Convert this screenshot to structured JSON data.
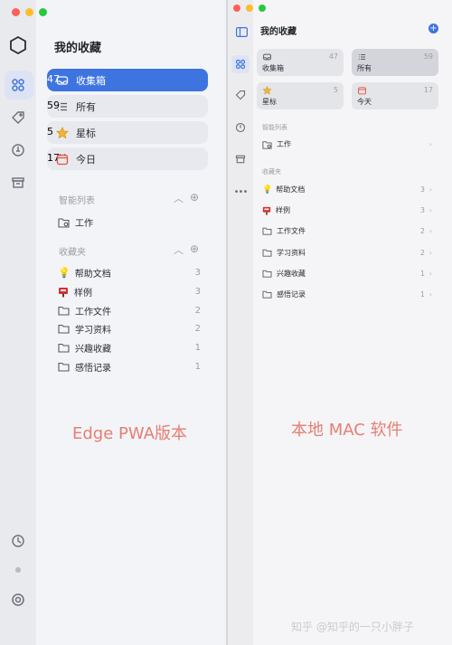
{
  "left": {
    "header": "我的收藏",
    "main_items": [
      {
        "label": "收集箱",
        "count": "47"
      },
      {
        "label": "所有",
        "count": "59"
      },
      {
        "label": "星标",
        "count": "5"
      },
      {
        "label": "今日",
        "count": "17"
      }
    ],
    "smart_list": {
      "title": "智能列表",
      "items": [
        {
          "label": "工作"
        }
      ]
    },
    "favorites": {
      "title": "收藏夹",
      "items": [
        {
          "label": "帮助文档",
          "count": "3"
        },
        {
          "label": "样例",
          "count": "3"
        },
        {
          "label": "工作文件",
          "count": "2"
        },
        {
          "label": "学习资料",
          "count": "2"
        },
        {
          "label": "兴趣收藏",
          "count": "1"
        },
        {
          "label": "感悟记录",
          "count": "1"
        }
      ]
    },
    "caption": "Edge PWA版本"
  },
  "right": {
    "header": "我的收藏",
    "cards": [
      {
        "label": "收集箱",
        "count": "47"
      },
      {
        "label": "所有",
        "count": "59"
      },
      {
        "label": "星标",
        "count": "5"
      },
      {
        "label": "今天",
        "count": "17"
      }
    ],
    "smart_list": {
      "title": "智能列表",
      "items": [
        {
          "label": "工作"
        }
      ]
    },
    "favorites": {
      "title": "收藏夹",
      "items": [
        {
          "label": "帮助文档",
          "count": "3"
        },
        {
          "label": "样例",
          "count": "3"
        },
        {
          "label": "工作文件",
          "count": "2"
        },
        {
          "label": "学习资料",
          "count": "2"
        },
        {
          "label": "兴趣收藏",
          "count": "1"
        },
        {
          "label": "感悟记录",
          "count": "1"
        }
      ]
    },
    "caption": "本地 MAC 软件"
  },
  "watermark": "知乎 @知乎的一只小胖子",
  "colors": {
    "accent": "#3d74e0",
    "caption": "#e67e73"
  }
}
